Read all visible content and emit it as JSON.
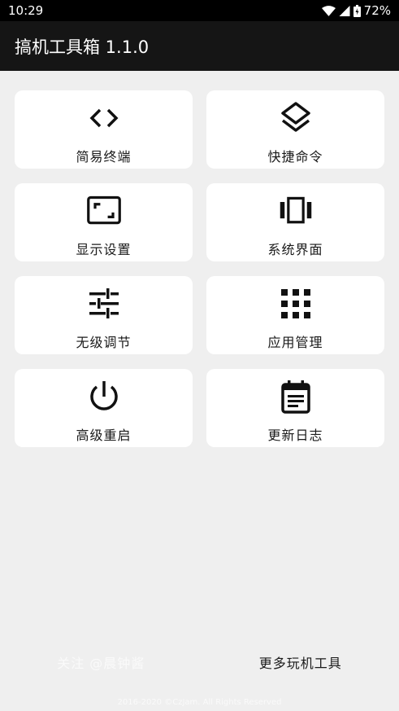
{
  "status_bar": {
    "time": "10:29",
    "battery": "72%",
    "icons": [
      "wifi-icon",
      "signal-icon",
      "battery-icon"
    ]
  },
  "app_bar": {
    "title": "搞机工具箱 1.1.0"
  },
  "cards": [
    {
      "label": "简易终端",
      "icon": "code-icon"
    },
    {
      "label": "快捷命令",
      "icon": "layers-icon"
    },
    {
      "label": "显示设置",
      "icon": "aspect-ratio-icon"
    },
    {
      "label": "系统界面",
      "icon": "view-carousel-icon"
    },
    {
      "label": "无级调节",
      "icon": "tune-icon"
    },
    {
      "label": "应用管理",
      "icon": "apps-icon"
    },
    {
      "label": "高级重启",
      "icon": "power-icon"
    },
    {
      "label": "更新日志",
      "icon": "event-note-icon"
    }
  ],
  "footer": {
    "follow": "关注 @晨钟酱",
    "more_tools": "更多玩机工具",
    "copyright": "2016-2020 ©CzJam. All Rights Reserved"
  },
  "colors": {
    "background": "#efefef",
    "app_bar": "#151515",
    "card": "#ffffff",
    "text": "#1a1a1a"
  }
}
